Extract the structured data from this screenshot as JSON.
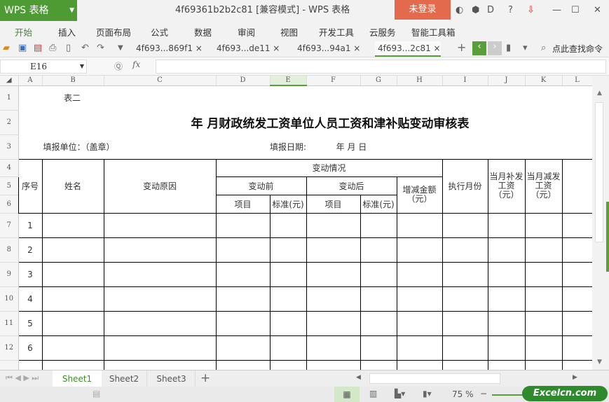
{
  "app": {
    "logo": "WPS 表格",
    "title": "4f69361b2b2c81 [兼容模式] - WPS 表格",
    "login": "未登录"
  },
  "menu": [
    "开始",
    "插入",
    "页面布局",
    "公式",
    "数据",
    "审阅",
    "视图",
    "开发工具",
    "云服务",
    "智能工具箱"
  ],
  "doc_tabs": [
    "4f693...869f1",
    "4f693...de11",
    "4f693...94a1",
    "4f693...2c81"
  ],
  "search_cmd": "点此查找命令",
  "name_box": "E16",
  "fx_label": "fx",
  "columns": [
    "A",
    "B",
    "C",
    "D",
    "E",
    "F",
    "G",
    "H",
    "I",
    "J",
    "K",
    "L"
  ],
  "rows": [
    "1",
    "2",
    "3",
    "4",
    "5",
    "6",
    "7",
    "8",
    "9",
    "10",
    "11",
    "12"
  ],
  "sheet": {
    "r1": "表二",
    "title": "年  月财政统发工资单位人员工资和津补贴变动审核表",
    "unit": "填报单位：（盖章）",
    "date_label": "填报日期:",
    "date_value": "年  月  日",
    "h_seq": "序号",
    "h_name": "姓名",
    "h_reason": "变动原因",
    "h_change": "变动情况",
    "h_before": "变动前",
    "h_after": "变动后",
    "h_item": "项目",
    "h_std": "标准(元)",
    "h_amount": "增减金额（元）",
    "h_month": "执行月份",
    "h_add": "当月补发工资（元）",
    "h_sub": "当月减发工资（元）",
    "seq": [
      "1",
      "2",
      "3",
      "4",
      "5",
      "6"
    ]
  },
  "sheets": [
    "Sheet1",
    "Sheet2",
    "Sheet3"
  ],
  "zoom": "75 %",
  "brand": "Excelcn.com"
}
